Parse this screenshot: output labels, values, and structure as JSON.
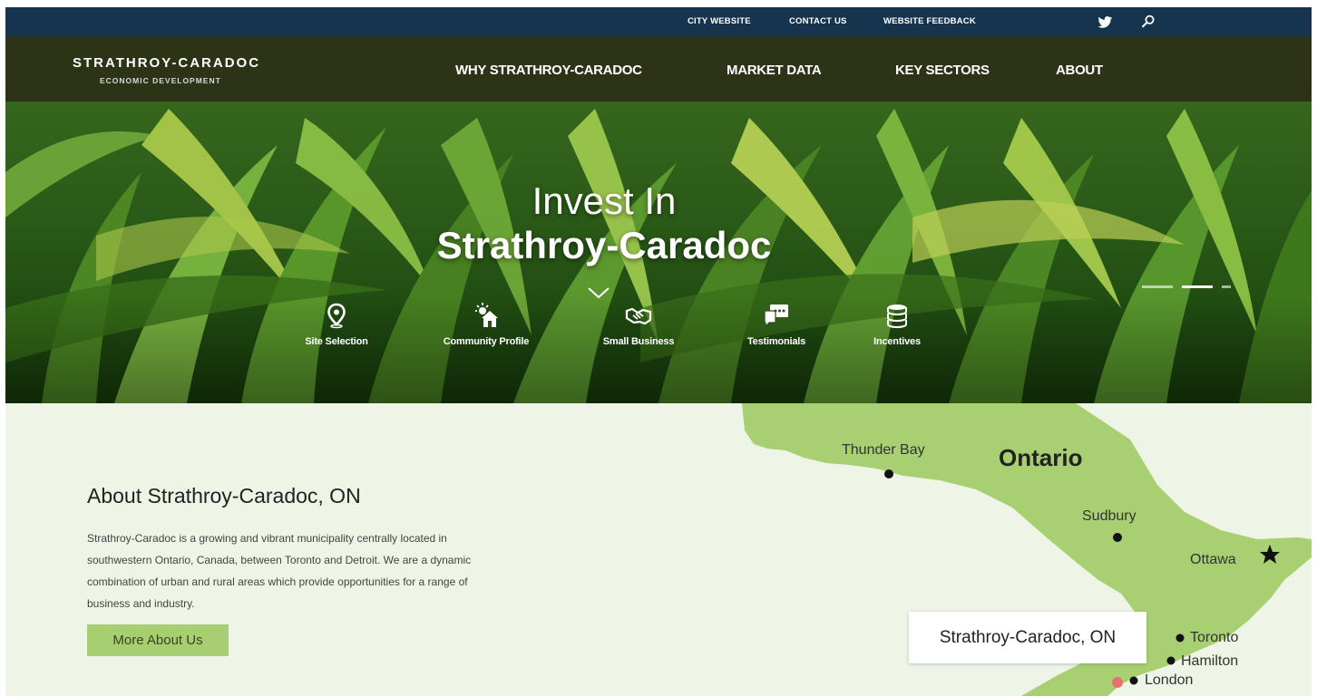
{
  "utility_bar": {
    "links": [
      "CITY WEBSITE",
      "CONTACT US",
      "WEBSITE FEEDBACK"
    ],
    "icons": [
      "twitter-icon",
      "search-icon"
    ],
    "bg_color": "#17344f"
  },
  "header": {
    "logo_title": "STRATHROY-CARADOC",
    "logo_subtitle": "ECONOMIC DEVELOPMENT",
    "nav": [
      "WHY STRATHROY-CARADOC",
      "MARKET DATA",
      "KEY SECTORS",
      "ABOUT"
    ]
  },
  "hero": {
    "headline_line1": "Invest In",
    "headline_line2": "Strathroy-Caradoc",
    "scroll_icon": "chevron-down-icon",
    "slides": 3,
    "active_slide": 2,
    "quick_links": [
      {
        "label": "Site Selection",
        "icon": "map-pin-icon"
      },
      {
        "label": "Community Profile",
        "icon": "sun-house-icon"
      },
      {
        "label": "Small Business",
        "icon": "handshake-icon"
      },
      {
        "label": "Testimonials",
        "icon": "chat-bubbles-icon"
      },
      {
        "label": "Incentives",
        "icon": "coin-stack-icon"
      }
    ]
  },
  "about": {
    "title": "About Strathroy-Caradoc, ON",
    "text": "Strathroy-Caradoc is a growing and vibrant municipality centrally located in southwestern Ontario, Canada, between Toronto and Detroit. We are a dynamic combination of urban and rural areas which provide opportunities for a range of business and industry.",
    "button_label": "More About Us",
    "accent_color": "#a7cf72"
  },
  "map": {
    "province_label": "Ontario",
    "cities": [
      "Thunder Bay",
      "Sudbury",
      "Ottawa",
      "Toronto",
      "Hamilton",
      "London"
    ],
    "callout": "Strathroy-Caradoc, ON",
    "land_color": "#a8d072",
    "highlight_color": "#e87070"
  }
}
